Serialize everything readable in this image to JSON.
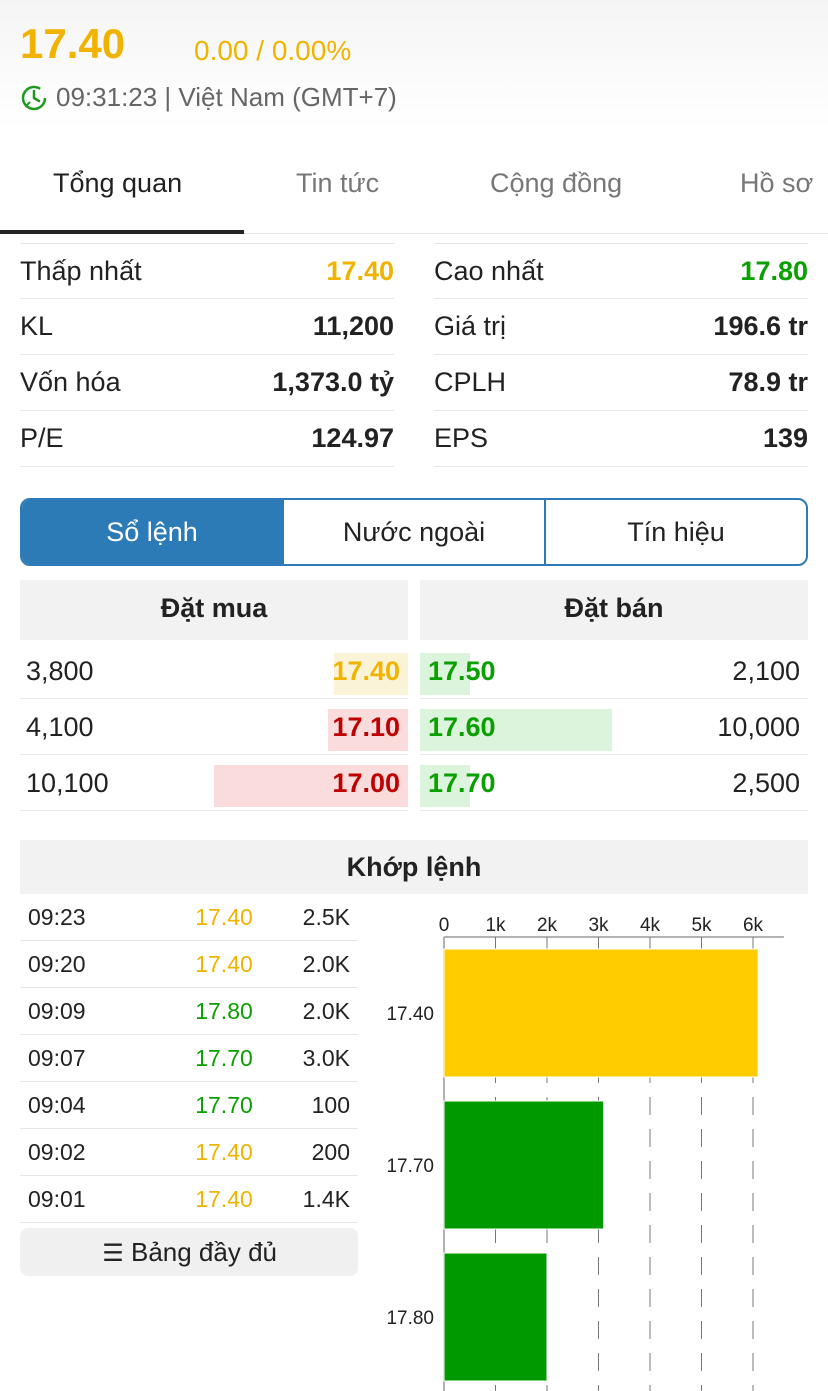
{
  "header": {
    "price": "17.40",
    "change": "0.00 / 0.00%",
    "timeline": "09:31:23 | Việt Nam (GMT+7)",
    "clock_icon": "clock-refresh-icon"
  },
  "tabs": [
    {
      "label": "Tổng quan",
      "active": true
    },
    {
      "label": "Tin tức",
      "active": false
    },
    {
      "label": "Cộng đồng",
      "active": false
    },
    {
      "label": "Hồ sơ",
      "active": false
    }
  ],
  "stats": {
    "left": [
      {
        "label": "Thấp nhất",
        "value": "17.40",
        "color": "#f0b400"
      },
      {
        "label": "KL",
        "value": "11,200",
        "color": "#222222"
      },
      {
        "label": "Vốn hóa",
        "value": "1,373.0 tỷ",
        "color": "#222222"
      },
      {
        "label": "P/E",
        "value": "124.97",
        "color": "#222222"
      }
    ],
    "right": [
      {
        "label": "Cao nhất",
        "value": "17.80",
        "color": "#0aa000"
      },
      {
        "label": "Giá trị",
        "value": "196.6 tr",
        "color": "#222222"
      },
      {
        "label": "CPLH",
        "value": "78.9 tr",
        "color": "#222222"
      },
      {
        "label": "EPS",
        "value": "139",
        "color": "#222222"
      }
    ]
  },
  "segments": [
    {
      "label": "Sổ lệnh",
      "active": true
    },
    {
      "label": "Nước ngoài",
      "active": false
    },
    {
      "label": "Tín hiệu",
      "active": false
    }
  ],
  "orderbook": {
    "buy_title": "Đặt mua",
    "sell_title": "Đặt bán",
    "buy": [
      {
        "qty": "3,800",
        "price": "17.40",
        "price_color": "#f0b400",
        "bar_color": "#faf3d8",
        "fill": 0.38
      },
      {
        "qty": "4,100",
        "price": "17.10",
        "price_color": "#c00000",
        "bar_color": "#fadcdc",
        "fill": 0.41
      },
      {
        "qty": "10,100",
        "price": "17.00",
        "price_color": "#c00000",
        "bar_color": "#fadcdc",
        "fill": 1.0
      }
    ],
    "sell": [
      {
        "price": "17.50",
        "qty": "2,100",
        "price_color": "#0aa000",
        "bar_color": "#dcf3dc",
        "fill": 0.21
      },
      {
        "price": "17.60",
        "qty": "10,000",
        "price_color": "#0aa000",
        "bar_color": "#dcf3dc",
        "fill": 1.0
      },
      {
        "price": "17.70",
        "qty": "2,500",
        "price_color": "#0aa000",
        "bar_color": "#dcf3dc",
        "fill": 0.25
      }
    ]
  },
  "match": {
    "title": "Khớp lệnh",
    "trades": [
      {
        "time": "09:23",
        "price": "17.40",
        "vol": "2.5K",
        "color": "#f0b400"
      },
      {
        "time": "09:20",
        "price": "17.40",
        "vol": "2.0K",
        "color": "#f0b400"
      },
      {
        "time": "09:09",
        "price": "17.80",
        "vol": "2.0K",
        "color": "#0aa000"
      },
      {
        "time": "09:07",
        "price": "17.70",
        "vol": "3.0K",
        "color": "#0aa000"
      },
      {
        "time": "09:04",
        "price": "17.70",
        "vol": "100",
        "color": "#0aa000"
      },
      {
        "time": "09:02",
        "price": "17.40",
        "vol": "200",
        "color": "#f0b400"
      },
      {
        "time": "09:01",
        "price": "17.40",
        "vol": "1.4K",
        "color": "#f0b400"
      }
    ],
    "full_table_label": "Bảng đầy đủ",
    "full_table_icon": "list-icon"
  },
  "chart_data": {
    "type": "bar",
    "orientation": "horizontal",
    "categories": [
      "17.40",
      "17.70",
      "17.80"
    ],
    "values": [
      6100,
      3100,
      2000
    ],
    "colors": [
      "#ffcc00",
      "#009900",
      "#009900"
    ],
    "x_ticks": [
      "0",
      "1k",
      "2k",
      "3k",
      "4k",
      "5k",
      "6k"
    ],
    "xlim": [
      0,
      6600
    ],
    "grid": true,
    "xlabel": "",
    "ylabel": ""
  }
}
